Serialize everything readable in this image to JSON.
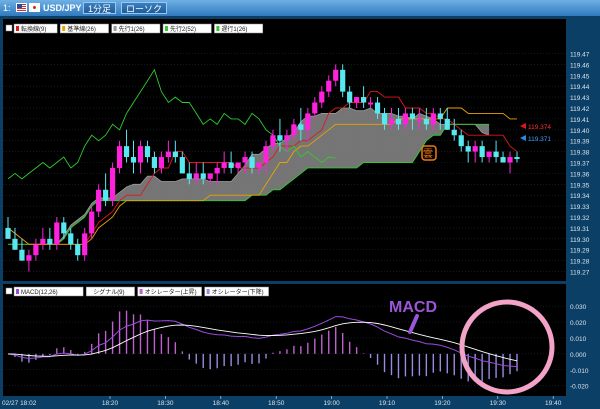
{
  "window": {
    "pane_number": "1:",
    "symbol": "USD/JPY",
    "timeframe_button": "1分足",
    "chart_type_button": "ローソク"
  },
  "main_panel": {
    "legend": [
      {
        "label": "転換線(9)",
        "color": "#e0161d"
      },
      {
        "label": "基準線(26)",
        "color": "#e8a400"
      },
      {
        "label": "先行1(26)",
        "color": "#9a9a9a"
      },
      {
        "label": "先行2(52)",
        "color": "#2ecb2e"
      },
      {
        "label": "遅行1(26)",
        "color": "#2ecb2e"
      }
    ],
    "price_tag_red": "119.374",
    "price_tag_blue": "119.371",
    "cloud_icon": "雲"
  },
  "sub_panel": {
    "legend": [
      {
        "label": "MACD(12,26)",
        "color": "#9b4be0"
      },
      {
        "label": "シグナル(9)",
        "color": "#ffffff"
      },
      {
        "label": "オシレーター(上昇)",
        "color": "#c060d0"
      },
      {
        "label": "オシレーター(下降)",
        "color": "#9a8be0"
      }
    ],
    "annotation": "MACD"
  },
  "x_axis": {
    "first_label": "02/27 18:02",
    "labels": [
      "18:20",
      "18:30",
      "18:40",
      "18:50",
      "19:00",
      "19:10",
      "19:20",
      "19:30",
      "19:40"
    ]
  },
  "chart_data": [
    {
      "type": "line",
      "name": "main",
      "y_ticks": [
        "119.47",
        "119.46",
        "119.45",
        "119.44",
        "119.43",
        "119.42",
        "119.41",
        "119.40",
        "119.39",
        "119.38",
        "119.37",
        "119.36",
        "119.35",
        "119.34",
        "119.33",
        "119.32",
        "119.31",
        "119.30",
        "119.29",
        "119.28",
        "119.27"
      ],
      "ylim": [
        119.265,
        119.475
      ],
      "candle_count": 74,
      "candles_ohlc": [
        [
          119.31,
          119.32,
          119.3,
          119.3
        ],
        [
          119.3,
          119.31,
          119.29,
          119.29
        ],
        [
          119.29,
          119.3,
          119.28,
          119.28
        ],
        [
          119.28,
          119.29,
          119.27,
          119.285
        ],
        [
          119.285,
          119.3,
          119.28,
          119.295
        ],
        [
          119.295,
          119.31,
          119.29,
          119.3
        ],
        [
          119.3,
          119.31,
          119.29,
          119.295
        ],
        [
          119.295,
          119.32,
          119.29,
          119.315
        ],
        [
          119.315,
          119.32,
          119.3,
          119.305
        ],
        [
          119.305,
          119.31,
          119.29,
          119.295
        ],
        [
          119.295,
          119.3,
          119.28,
          119.285
        ],
        [
          119.285,
          119.31,
          119.28,
          119.305
        ],
        [
          119.305,
          119.33,
          119.3,
          119.325
        ],
        [
          119.325,
          119.35,
          119.32,
          119.345
        ],
        [
          119.345,
          119.36,
          119.33,
          119.335
        ],
        [
          119.335,
          119.37,
          119.33,
          119.365
        ],
        [
          119.365,
          119.39,
          119.36,
          119.385
        ],
        [
          119.385,
          119.4,
          119.37,
          119.375
        ],
        [
          119.375,
          119.39,
          119.36,
          119.37
        ],
        [
          119.37,
          119.39,
          119.36,
          119.385
        ],
        [
          119.385,
          119.39,
          119.37,
          119.375
        ],
        [
          119.375,
          119.38,
          119.36,
          119.365
        ],
        [
          119.365,
          119.38,
          119.36,
          119.375
        ],
        [
          119.375,
          119.39,
          119.37,
          119.38
        ],
        [
          119.38,
          119.39,
          119.37,
          119.375
        ],
        [
          119.375,
          119.38,
          119.36,
          119.36
        ],
        [
          119.36,
          119.37,
          119.35,
          119.355
        ],
        [
          119.355,
          119.37,
          119.35,
          119.36
        ],
        [
          119.36,
          119.37,
          119.35,
          119.355
        ],
        [
          119.355,
          119.36,
          119.35,
          119.36
        ],
        [
          119.36,
          119.37,
          119.35,
          119.365
        ],
        [
          119.365,
          119.38,
          119.36,
          119.37
        ],
        [
          119.37,
          119.38,
          119.36,
          119.365
        ],
        [
          119.365,
          119.37,
          119.36,
          119.37
        ],
        [
          119.37,
          119.38,
          119.36,
          119.375
        ],
        [
          119.375,
          119.38,
          119.36,
          119.365
        ],
        [
          119.365,
          119.37,
          119.36,
          119.37
        ],
        [
          119.37,
          119.39,
          119.36,
          119.385
        ],
        [
          119.385,
          119.4,
          119.38,
          119.395
        ],
        [
          119.395,
          119.41,
          119.38,
          119.39
        ],
        [
          119.39,
          119.4,
          119.38,
          119.395
        ],
        [
          119.395,
          119.41,
          119.39,
          119.405
        ],
        [
          119.405,
          119.42,
          119.39,
          119.4
        ],
        [
          119.4,
          119.42,
          119.39,
          119.415
        ],
        [
          119.415,
          119.43,
          119.41,
          119.425
        ],
        [
          119.425,
          119.44,
          119.42,
          119.435
        ],
        [
          119.435,
          119.45,
          119.43,
          119.445
        ],
        [
          119.445,
          119.46,
          119.44,
          119.455
        ],
        [
          119.455,
          119.46,
          119.43,
          119.435
        ],
        [
          119.435,
          119.44,
          119.42,
          119.425
        ],
        [
          119.425,
          119.43,
          119.42,
          119.43
        ],
        [
          119.43,
          119.44,
          119.42,
          119.425
        ],
        [
          119.425,
          119.43,
          119.42,
          119.425
        ],
        [
          119.425,
          119.43,
          119.41,
          119.415
        ],
        [
          119.415,
          119.42,
          119.4,
          119.405
        ],
        [
          119.405,
          119.42,
          119.4,
          119.41
        ],
        [
          119.41,
          119.42,
          119.4,
          119.405
        ],
        [
          119.405,
          119.42,
          119.4,
          119.415
        ],
        [
          119.415,
          119.42,
          119.4,
          119.41
        ],
        [
          119.41,
          119.42,
          119.4,
          119.41
        ],
        [
          119.41,
          119.42,
          119.4,
          119.405
        ],
        [
          119.405,
          119.42,
          119.4,
          119.415
        ],
        [
          119.415,
          119.42,
          119.4,
          119.41
        ],
        [
          119.41,
          119.42,
          119.4,
          119.4
        ],
        [
          119.4,
          119.41,
          119.39,
          119.395
        ],
        [
          119.395,
          119.4,
          119.38,
          119.385
        ],
        [
          119.385,
          119.39,
          119.37,
          119.38
        ],
        [
          119.38,
          119.39,
          119.37,
          119.385
        ],
        [
          119.385,
          119.39,
          119.37,
          119.375
        ],
        [
          119.375,
          119.38,
          119.37,
          119.38
        ],
        [
          119.38,
          119.39,
          119.37,
          119.375
        ],
        [
          119.375,
          119.38,
          119.37,
          119.37
        ],
        [
          119.37,
          119.38,
          119.36,
          119.375
        ],
        [
          119.375,
          119.38,
          119.37,
          119.374
        ]
      ]
    },
    {
      "type": "line",
      "name": "sub",
      "y_ticks": [
        "0.030",
        "0.020",
        "0.010",
        "0.000",
        "-0.010",
        "-0.020"
      ],
      "ylim": [
        -0.024,
        0.032
      ]
    }
  ]
}
